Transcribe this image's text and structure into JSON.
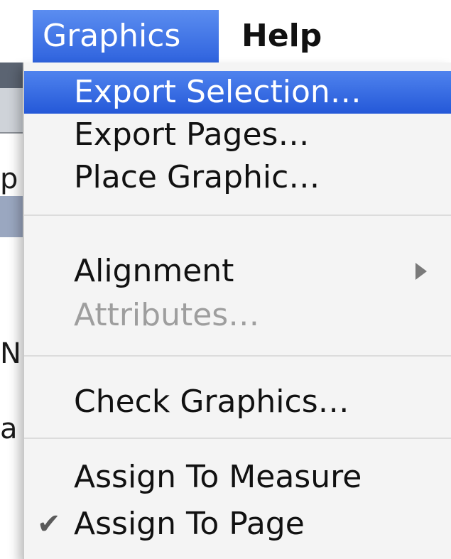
{
  "menubar": {
    "graphics_label": "Graphics",
    "help_label": "Help"
  },
  "background": {
    "char_p": "p",
    "char_n": "N",
    "char_a": "a"
  },
  "menu": {
    "items": [
      {
        "label": "Export Selection…",
        "state": "highlighted"
      },
      {
        "label": "Export Pages…",
        "state": "normal"
      },
      {
        "label": "Place Graphic…",
        "state": "normal"
      },
      {
        "label": "Alignment",
        "state": "normal",
        "submenu": true,
        "arrow_icon": "submenu-arrow-icon"
      },
      {
        "label": "Attributes…",
        "state": "disabled"
      },
      {
        "label": "Check Graphics…",
        "state": "normal"
      },
      {
        "label": "Assign To Measure",
        "state": "normal"
      },
      {
        "label": "Assign To Page",
        "state": "normal",
        "checked": true,
        "check_glyph": "✔"
      }
    ]
  },
  "colors": {
    "highlight": "#2f63de",
    "disabled_text": "#9e9e9e",
    "menu_background": "#f4f4f4"
  }
}
